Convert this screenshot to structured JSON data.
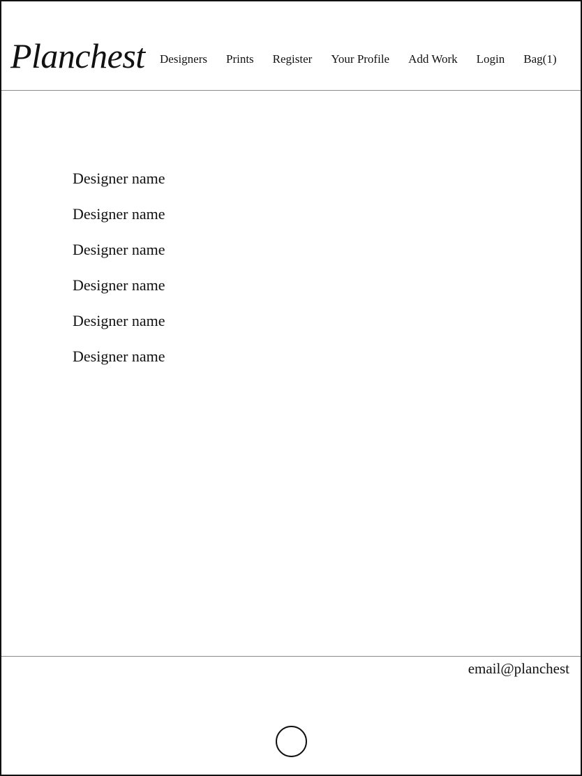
{
  "header": {
    "logo": "Planchest",
    "nav": [
      {
        "label": "Designers"
      },
      {
        "label": "Prints"
      },
      {
        "label": "Register"
      },
      {
        "label": "Your Profile"
      },
      {
        "label": "Add Work"
      },
      {
        "label": "Login"
      },
      {
        "label": "Bag(1)"
      }
    ]
  },
  "main": {
    "designers": [
      {
        "name": "Designer name"
      },
      {
        "name": "Designer name"
      },
      {
        "name": "Designer name"
      },
      {
        "name": "Designer name"
      },
      {
        "name": "Designer name"
      },
      {
        "name": "Designer name"
      }
    ]
  },
  "footer": {
    "email": "email@planchest"
  },
  "device": {
    "home_button_icon": "circle-home-button"
  }
}
